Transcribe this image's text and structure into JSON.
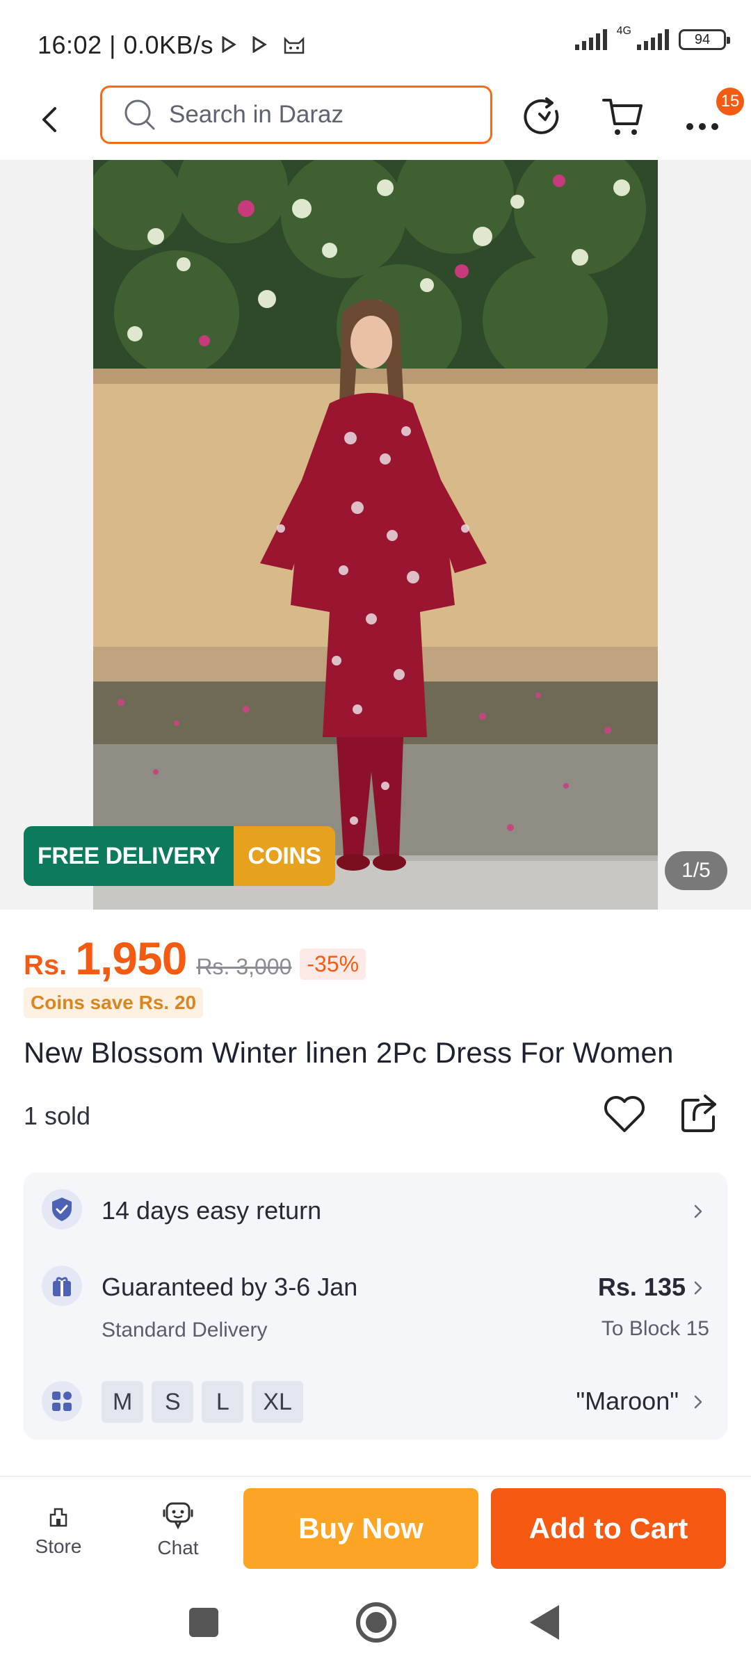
{
  "status_bar": {
    "time": "16:02 | 0.0KB/s",
    "network_label": "4G",
    "battery": "94"
  },
  "header": {
    "search_placeholder": "Search in Daraz",
    "more_badge": "15"
  },
  "gallery": {
    "promo_free_delivery": "FREE DELIVERY",
    "promo_coins": "COINS",
    "page_indicator": "1/5"
  },
  "product": {
    "currency": "Rs.",
    "price": "1,950",
    "old_price": "Rs. 3,000",
    "discount": "-35%",
    "coins_save": "Coins save Rs. 20",
    "title": "New Blossom Winter linen 2Pc Dress For Women",
    "sold": "1 sold"
  },
  "info": {
    "returns": "14 days easy return",
    "delivery_guarantee": "Guaranteed by 3-6 Jan",
    "delivery_type": "Standard Delivery",
    "delivery_fee": "Rs. 135",
    "delivery_location": "To Block 15",
    "sizes": [
      "M",
      "S",
      "L",
      "XL"
    ],
    "selected_color": "\"Maroon\""
  },
  "bottom_bar": {
    "store_label": "Store",
    "chat_label": "Chat",
    "buy_now": "Buy Now",
    "add_to_cart": "Add to Cart"
  },
  "colors": {
    "accent": "#f35b12",
    "buy_now": "#fca524",
    "free_delivery": "#0d7a5e",
    "coins": "#e6a11e"
  }
}
